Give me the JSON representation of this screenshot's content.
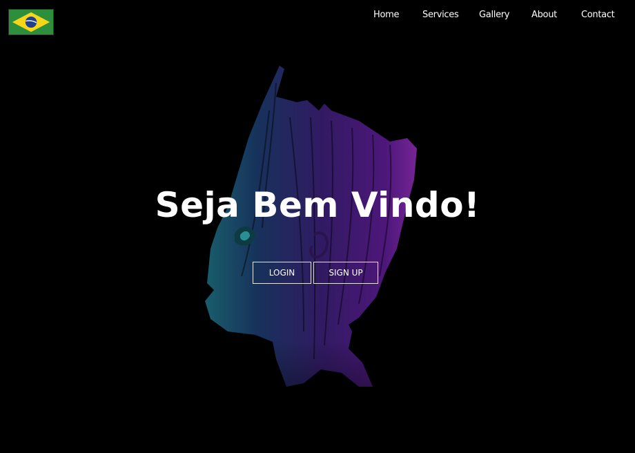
{
  "header": {
    "logo": {
      "icon": "brazil-flag-icon",
      "colors": {
        "green": "#2d8f3c",
        "yellow": "#f7d619",
        "blue": "#1f3f8f"
      }
    },
    "nav": [
      {
        "label": "Home"
      },
      {
        "label": "Services"
      },
      {
        "label": "Gallery"
      },
      {
        "label": "About"
      },
      {
        "label": "Contact"
      }
    ]
  },
  "hero": {
    "title": "Seja Bem Vindo!",
    "buttons": {
      "login": "LOGIN",
      "signup": "SIGN UP"
    },
    "background_art": "groot-head-illustration",
    "colors": {
      "teal": "#1e7f87",
      "blue": "#1c3566",
      "purple": "#6a1fa0",
      "magenta": "#a42cc0"
    }
  }
}
